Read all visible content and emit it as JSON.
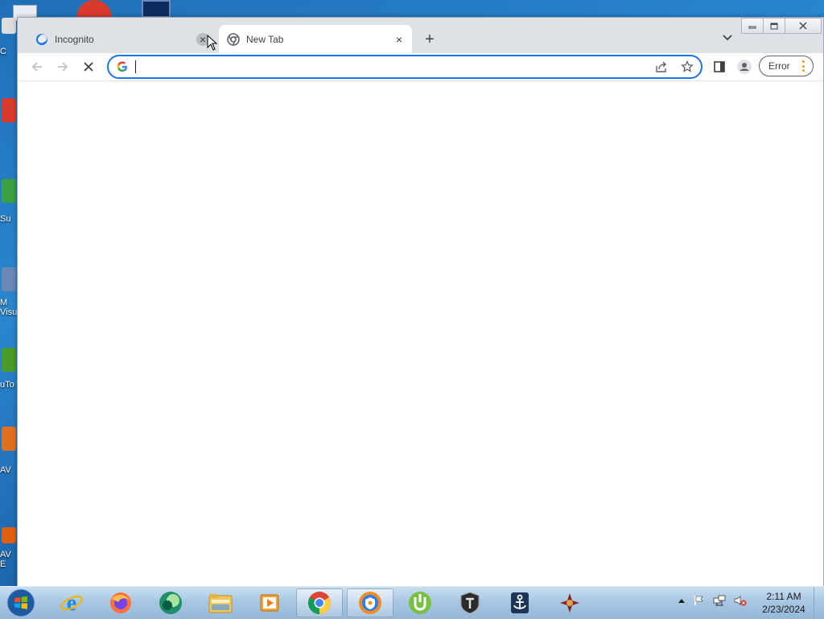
{
  "desktop": {
    "icons": [
      {
        "label": "C",
        "color": "#dddddd"
      },
      {
        "label": "",
        "color": "#d83b2b"
      },
      {
        "label": "Su",
        "color": "#3aa040"
      },
      {
        "label": "M Visu",
        "color": "#6a88b6"
      },
      {
        "label": "uTo",
        "color": "#4a9c2a"
      },
      {
        "label": "AV",
        "color": "#e07020"
      },
      {
        "label": "AV E",
        "color": "#e06010"
      }
    ]
  },
  "browser": {
    "tabs": [
      {
        "title": "Incognito",
        "close": "×"
      },
      {
        "title": "New Tab",
        "close": "×"
      }
    ],
    "new_tab": "+",
    "omnibox": {
      "value": "",
      "placeholder": ""
    },
    "profile_status": "Error"
  },
  "taskbar": {
    "items": [
      {
        "name": "internet-explorer"
      },
      {
        "name": "firefox"
      },
      {
        "name": "app-green-circle"
      },
      {
        "name": "file-explorer"
      },
      {
        "name": "media-player"
      },
      {
        "name": "chrome",
        "active": true
      },
      {
        "name": "vpn-app",
        "active": true
      },
      {
        "name": "utorrent"
      },
      {
        "name": "world-of-tanks"
      },
      {
        "name": "world-of-warships"
      },
      {
        "name": "red-app"
      }
    ],
    "time": "2:11 AM",
    "date": "2/23/2024"
  },
  "colors": {
    "accent": "#1a73e8",
    "tabstrip": "#dee1e6",
    "error_dots": "#e8a200"
  }
}
